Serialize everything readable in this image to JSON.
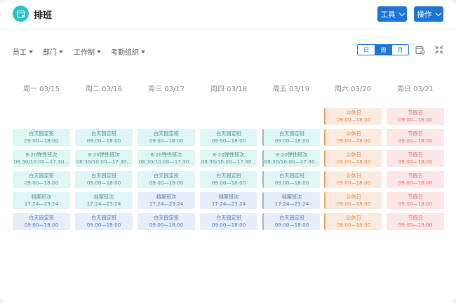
{
  "header": {
    "title": "排班",
    "tools_label": "工具",
    "ops_label": "操作"
  },
  "filters": {
    "employee": "员工",
    "department": "部门",
    "work_system": "工作制",
    "attendance_org": "考勤组织"
  },
  "view_switch": {
    "day": "日",
    "week": "周",
    "month": "月",
    "active": "week"
  },
  "days": [
    {
      "label": "周一 03/15"
    },
    {
      "label": "周二 03/16"
    },
    {
      "label": "周三 03/17"
    },
    {
      "label": "周四 03/18"
    },
    {
      "label": "周五 03/19"
    },
    {
      "label": "周六 03/20"
    },
    {
      "label": "周日 03/21"
    }
  ],
  "rows": [
    [
      null,
      null,
      null,
      null,
      null,
      {
        "name": "公休日",
        "time": "09:00—18:00",
        "style": "orange"
      },
      {
        "name": "节假日",
        "time": "09:00—18:00",
        "style": "pink"
      }
    ],
    [
      {
        "name": "白天固定班",
        "time": "09:00—18:00",
        "style": "teal"
      },
      {
        "name": "白天固定班",
        "time": "09:00—18:00",
        "style": "teal"
      },
      {
        "name": "白天固定班",
        "time": "09:00—18:00",
        "style": "teal"
      },
      {
        "name": "白天固定班",
        "time": "09:00—18:00",
        "style": "teal"
      },
      {
        "name": "白天固定班",
        "time": "09:00—18:00",
        "style": "teal",
        "marked": true
      },
      {
        "name": "公休日",
        "time": "09:00—18:00",
        "style": "orange"
      },
      {
        "name": "节假日",
        "time": "09:00—18:00",
        "style": "pink"
      }
    ],
    [
      {
        "name": "8-20弹性班次",
        "time": "08:30/10:00—17:30...",
        "style": "teal"
      },
      {
        "name": "8-20弹性班次",
        "time": "08:30/10:00—17:30...",
        "style": "teal"
      },
      {
        "name": "8-20弹性班次",
        "time": "08:30/10:00—17:30...",
        "style": "teal"
      },
      {
        "name": "8-20弹性班次",
        "time": "08:30/10:00—17:30...",
        "style": "teal"
      },
      {
        "name": "8-20弹性班次",
        "time": "08:30/10:00—17:30...",
        "style": "teal",
        "marked": true
      },
      {
        "name": "公休日",
        "time": "09:00—18:00",
        "style": "orange"
      },
      {
        "name": "节假日",
        "time": "09:00—18:00",
        "style": "pink"
      }
    ],
    [
      {
        "name": "白天固定班",
        "time": "09:00—18:00",
        "style": "teal"
      },
      {
        "name": "白天固定班",
        "time": "09:00—18:00",
        "style": "teal"
      },
      {
        "name": "白天固定班",
        "time": "09:00—18:00",
        "style": "teal"
      },
      {
        "name": "白天固定班",
        "time": "09:00—18:00",
        "style": "teal"
      },
      {
        "name": "白天固定班",
        "time": "09:00—18:00",
        "style": "teal",
        "marked": true
      },
      {
        "name": "公休日",
        "time": "09:00—18:00",
        "style": "orange"
      },
      {
        "name": "节假日",
        "time": "09:00—18:00",
        "style": "pink"
      }
    ],
    [
      {
        "name": "档案班次",
        "time": "17:24—23:24",
        "style": "teal"
      },
      {
        "name": "档案班次",
        "time": "17:24—23:24",
        "style": "teal"
      },
      {
        "name": "档案班次",
        "time": "17:24—23:24",
        "style": "blue"
      },
      {
        "name": "档案班次",
        "time": "17:24—23:24",
        "style": "blue"
      },
      {
        "name": "档案班次",
        "time": "17:24—23:24",
        "style": "blue",
        "marked": true
      },
      {
        "name": "公休日",
        "time": "09:00—18:00",
        "style": "orange"
      },
      {
        "name": "节假日",
        "time": "09:00—18:00",
        "style": "pink"
      }
    ],
    [
      {
        "name": "白天固定班",
        "time": "09:00—18:00",
        "style": "blue"
      },
      {
        "name": "白天固定班",
        "time": "09:00—18:00",
        "style": "blue"
      },
      {
        "name": "白天固定班",
        "time": "09:00—18:00",
        "style": "blue"
      },
      {
        "name": "白天固定班",
        "time": "09:00—18:00",
        "style": "blue"
      },
      {
        "name": "白天固定班",
        "time": "09:00—18:00",
        "style": "blue",
        "marked": true
      },
      {
        "name": "公休日",
        "time": "09:00—18:00",
        "style": "orange"
      },
      {
        "name": "节假日",
        "time": "09:00—18:00",
        "style": "pink"
      }
    ]
  ]
}
